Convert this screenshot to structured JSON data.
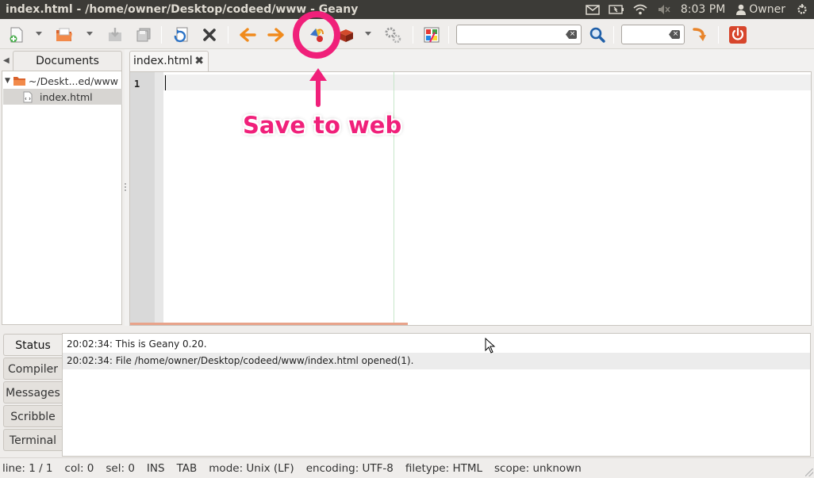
{
  "window": {
    "title": "index.html - /home/owner/Desktop/codeed/www - Geany"
  },
  "panel": {
    "clock": "8:03 PM",
    "user": "Owner",
    "indicators": [
      "mail-icon",
      "battery-icon",
      "wifi-icon",
      "volume-muted-icon",
      "power-gear-icon"
    ]
  },
  "toolbar": {
    "buttons": [
      "new-file",
      "open-file",
      "save",
      "save-all",
      "revert",
      "close",
      "navigate-back",
      "navigate-forward",
      "save-to-web",
      "build",
      "build-settings",
      "color-chooser",
      "search",
      "goto-line",
      "quit"
    ],
    "search_value": "",
    "goto_value": ""
  },
  "sidebar": {
    "tab_label": "Documents",
    "tree": [
      {
        "label": "~/Deskt...ed/www",
        "type": "folder"
      },
      {
        "label": "index.html",
        "type": "file"
      }
    ]
  },
  "editor": {
    "tab_label": "index.html",
    "line_numbers": [
      "1"
    ]
  },
  "annotation": {
    "text": "Save to web",
    "color": "#f0207a"
  },
  "messages": {
    "tabs": [
      "Status",
      "Compiler",
      "Messages",
      "Scribble",
      "Terminal"
    ],
    "active_tab": "Status",
    "lines": [
      "20:02:34: This is Geany 0.20.",
      "20:02:34: File /home/owner/Desktop/codeed/www/index.html opened(1)."
    ]
  },
  "statusbar": {
    "line": "line: 1 / 1",
    "col": "col: 0",
    "sel": "sel: 0",
    "ins": "INS",
    "tab": "TAB",
    "mode": "mode: Unix (LF)",
    "encoding": "encoding: UTF-8",
    "filetype": "filetype: HTML",
    "scope": "scope: unknown"
  }
}
